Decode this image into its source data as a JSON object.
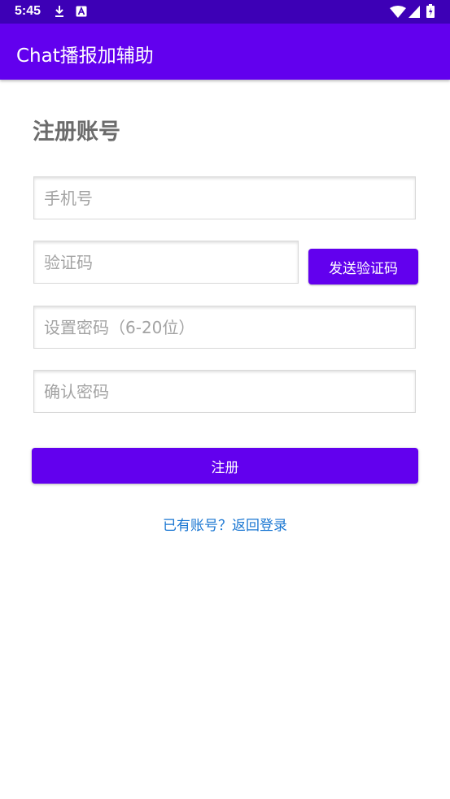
{
  "status_bar": {
    "time": "5:45",
    "icons": [
      "download-icon",
      "a-notification-icon",
      "wifi-icon",
      "signal-icon",
      "battery-icon"
    ]
  },
  "app_bar": {
    "title": "Chat播报加辅助",
    "color": "#6200ee"
  },
  "form": {
    "heading": "注册账号",
    "phone_placeholder": "手机号",
    "phone_value": "",
    "code_placeholder": "验证码",
    "code_value": "",
    "send_code_label": "发送验证码",
    "password_placeholder": "设置密码（6-20位）",
    "password_value": "",
    "confirm_placeholder": "确认密码",
    "confirm_value": "",
    "register_label": "注册",
    "login_link": "已有账号？返回登录"
  },
  "colors": {
    "primary": "#6200ee",
    "status_bar": "#3d00b6",
    "link": "#1976d2",
    "heading": "#6b6b6b"
  }
}
